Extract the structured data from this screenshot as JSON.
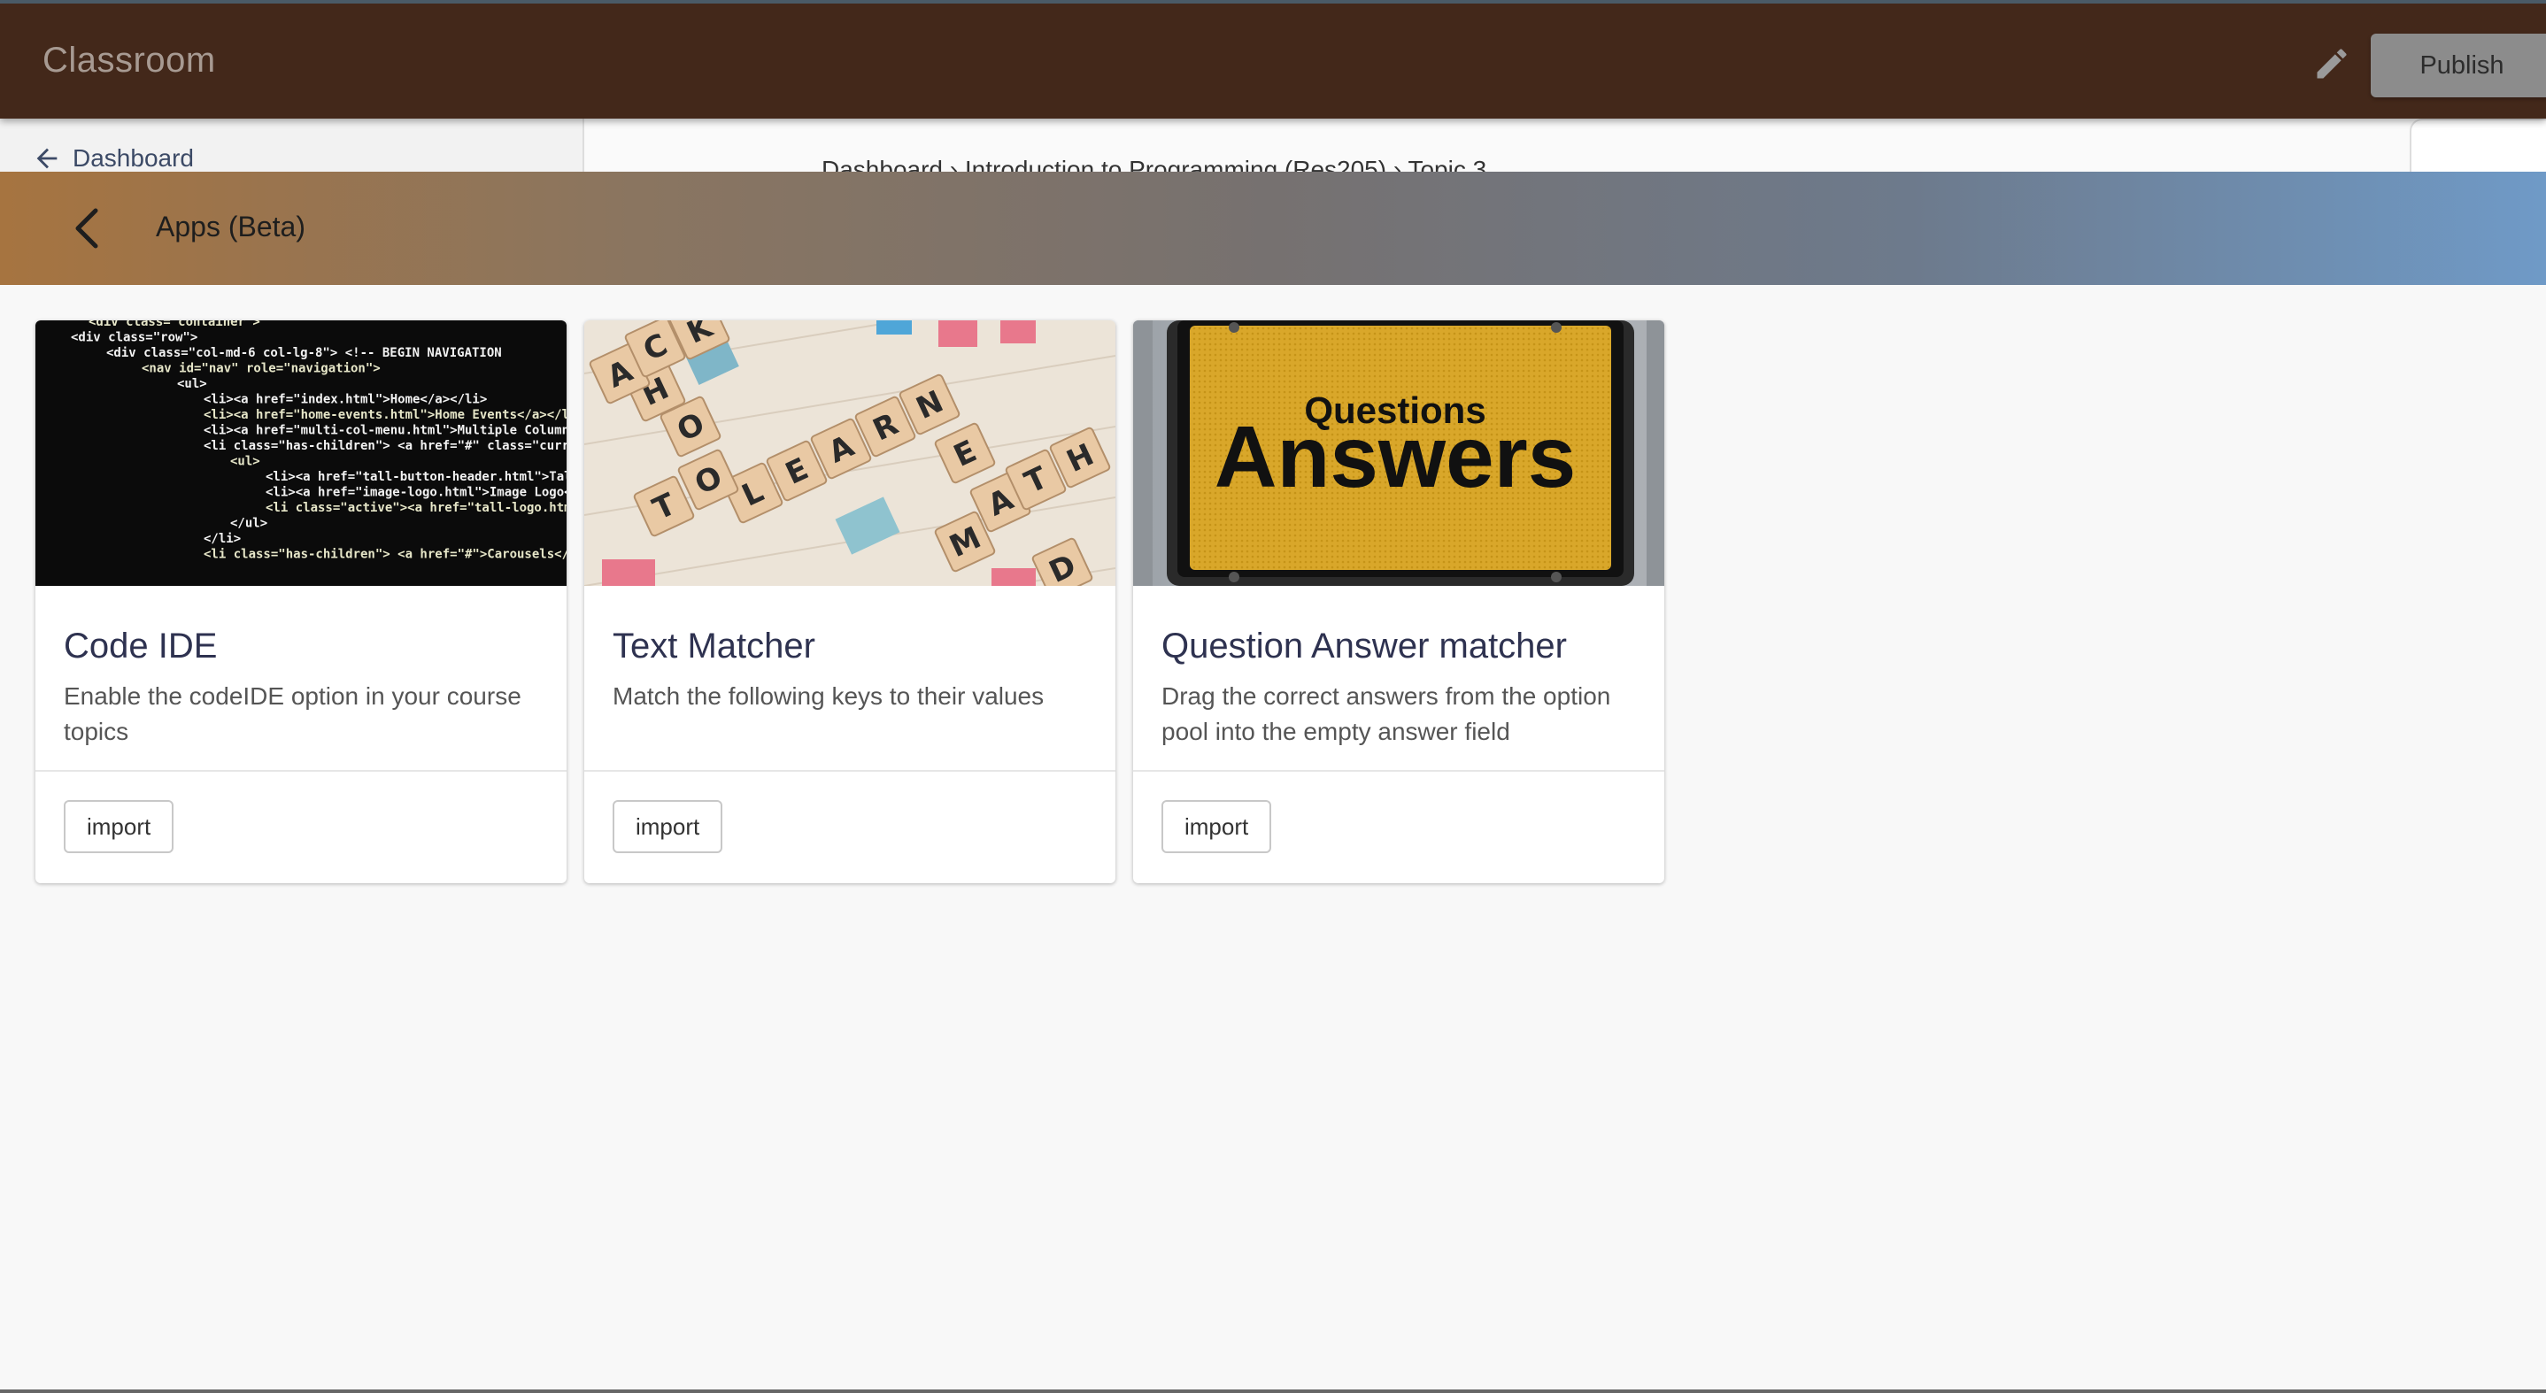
{
  "topbar": {
    "app_title": "Classroom",
    "edit_icon": "pencil-icon",
    "publish_label": "Publish"
  },
  "underlay": {
    "dashboard_label": "Dashboard",
    "breadcrumb_text": "Dashboard  ›  Introduction to Programming (Res205)  ›  Topic 3"
  },
  "panel": {
    "back_icon": "chevron-left-icon",
    "title": "Apps (Beta)"
  },
  "cards": [
    {
      "title": "Code IDE",
      "description": "Enable the codeIDE option in your course topics",
      "button_label": "import",
      "image_icon": "code-screenshot-image"
    },
    {
      "title": "Text Matcher",
      "description": "Match the following keys to their values",
      "button_label": "import",
      "image_icon": "scrabble-tiles-image"
    },
    {
      "title": "Question Answer matcher",
      "description": "Drag the correct answers from the option pool into the empty answer field",
      "button_label": "import",
      "image_icon": "questions-answers-sign-image"
    }
  ],
  "images": {
    "code_lines": [
      "<div class=\"container\">",
      "<div class=\"row\">",
      "<div class=\"col-md-6 col-lg-8\"> <!--  BEGIN NAVIGATION",
      "<nav id=\"nav\" role=\"navigation\">",
      "<ul>",
      "<li><a href=\"index.html\">Home</a></li>",
      "<li><a href=\"home-events.html\">Home Events</a></li>",
      "<li><a href=\"multi-col-menu.html\">Multiple Column Menu",
      "<li class=\"has-children\"> <a href=\"#\" class=\"current\">",
      "<ul>",
      "<li><a href=\"tall-button-header.html\">Tall Butt",
      "<li><a href=\"image-logo.html\">Image Logo</a></",
      "<li class=\"active\"><a href=\"tall-logo.html\">Ta",
      "</ul>",
      "</li>",
      "<li class=\"has-children\"> <a href=\"#\">Carousels</a>"
    ],
    "sign_small": "Questions",
    "sign_big": "Answers",
    "tile_letters": [
      "L",
      "E",
      "A",
      "R",
      "N",
      "M",
      "A",
      "T",
      "H",
      "T",
      "O",
      "O",
      "H",
      "A",
      "C",
      "K",
      "E",
      "D"
    ]
  },
  "colors": {
    "topbar_bg": "#43281a",
    "header_gradient_start": "#a67440",
    "header_gradient_end": "#6f9ac7",
    "card_title": "#2e3250"
  }
}
